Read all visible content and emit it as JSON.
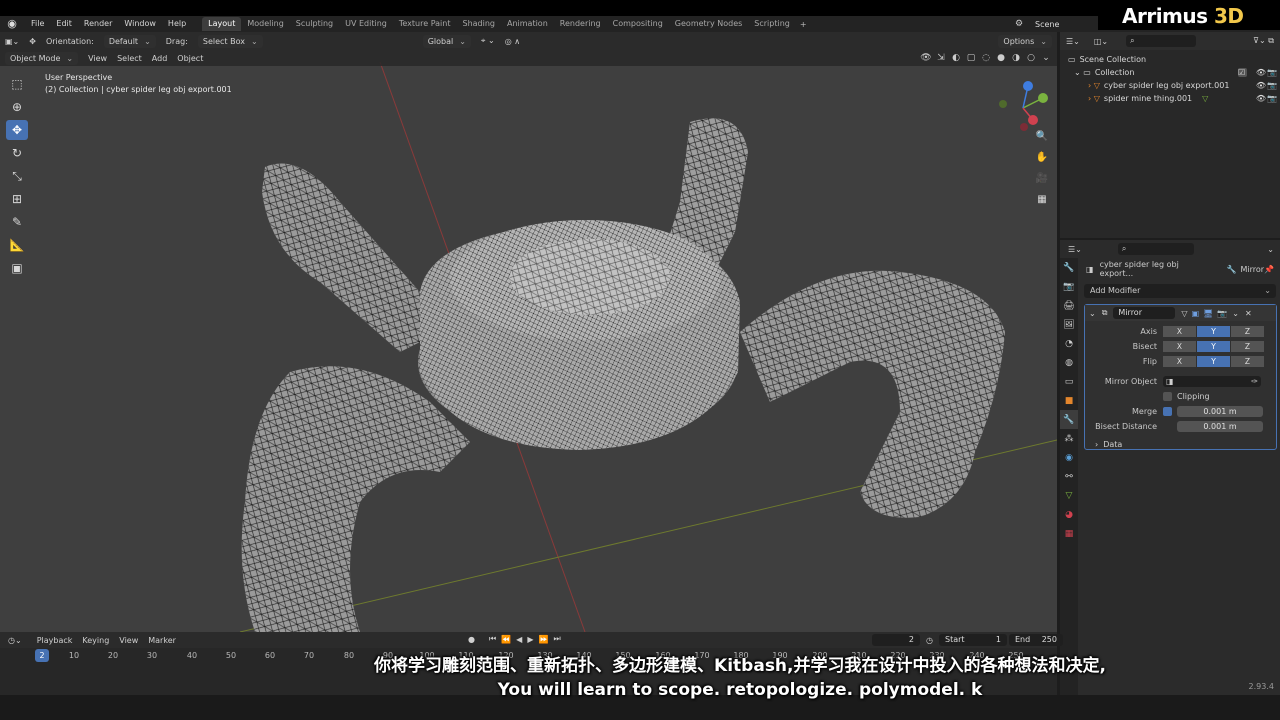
{
  "brand": {
    "name": "Arrimus ",
    "suffix": "3D"
  },
  "menu": [
    "File",
    "Edit",
    "Render",
    "Window",
    "Help"
  ],
  "workspaces": [
    "Layout",
    "Modeling",
    "Sculpting",
    "UV Editing",
    "Texture Paint",
    "Shading",
    "Animation",
    "Rendering",
    "Compositing",
    "Geometry Nodes",
    "Scripting"
  ],
  "active_workspace": "Layout",
  "scene": {
    "label": "Scene"
  },
  "viewport": {
    "orientation_label": "Orientation:",
    "orientation_value": "Default",
    "drag_label": "Drag:",
    "drag_value": "Select Box",
    "transform": "Global",
    "options": "Options",
    "mode": "Object Mode",
    "header_menus": [
      "View",
      "Select",
      "Add",
      "Object"
    ],
    "perspective": "User Perspective",
    "collection_info": "(2) Collection | cyber spider leg obj export.001"
  },
  "outliner": {
    "root": "Scene Collection",
    "collection": "Collection",
    "items": [
      "cyber spider leg obj export.001",
      "spider mine thing.001"
    ]
  },
  "properties": {
    "object_name": "cyber spider leg obj export...",
    "modifier_label": "Mirror",
    "add_modifier": "Add Modifier",
    "modifier_name": "Mirror",
    "axis_label": "Axis",
    "bisect_label": "Bisect",
    "flip_label": "Flip",
    "xyz": [
      "X",
      "Y",
      "Z"
    ],
    "mirror_object_label": "Mirror Object",
    "clipping_label": "Clipping",
    "merge_label": "Merge",
    "merge_value": "0.001 m",
    "bisect_distance_label": "Bisect Distance",
    "bisect_distance_value": "0.001 m",
    "data_label": "Data"
  },
  "timeline": {
    "menus": [
      "Playback",
      "Keying",
      "View",
      "Marker"
    ],
    "current_frame": "2",
    "start_label": "Start",
    "start_value": "1",
    "end_label": "End",
    "end_value": "250",
    "ruler": [
      "2",
      "10",
      "20",
      "30",
      "40",
      "50",
      "60",
      "70",
      "80",
      "90",
      "100",
      "110",
      "120",
      "130",
      "140",
      "150",
      "160",
      "170",
      "180",
      "190",
      "200",
      "210",
      "220",
      "230",
      "240",
      "250"
    ]
  },
  "version": "2.93.4",
  "subtitles": {
    "cn": "你将学习雕刻范围、重新拓扑、多边形建模、Kitbash,并学习我在设计中投入的各种想法和决定,",
    "en": "You will learn to scope. retopologize. polymodel. k"
  },
  "colors": {
    "accent": "#4772b3",
    "viewport_bg": "#3f3f3f",
    "brand_3d": "#f2c84b"
  }
}
